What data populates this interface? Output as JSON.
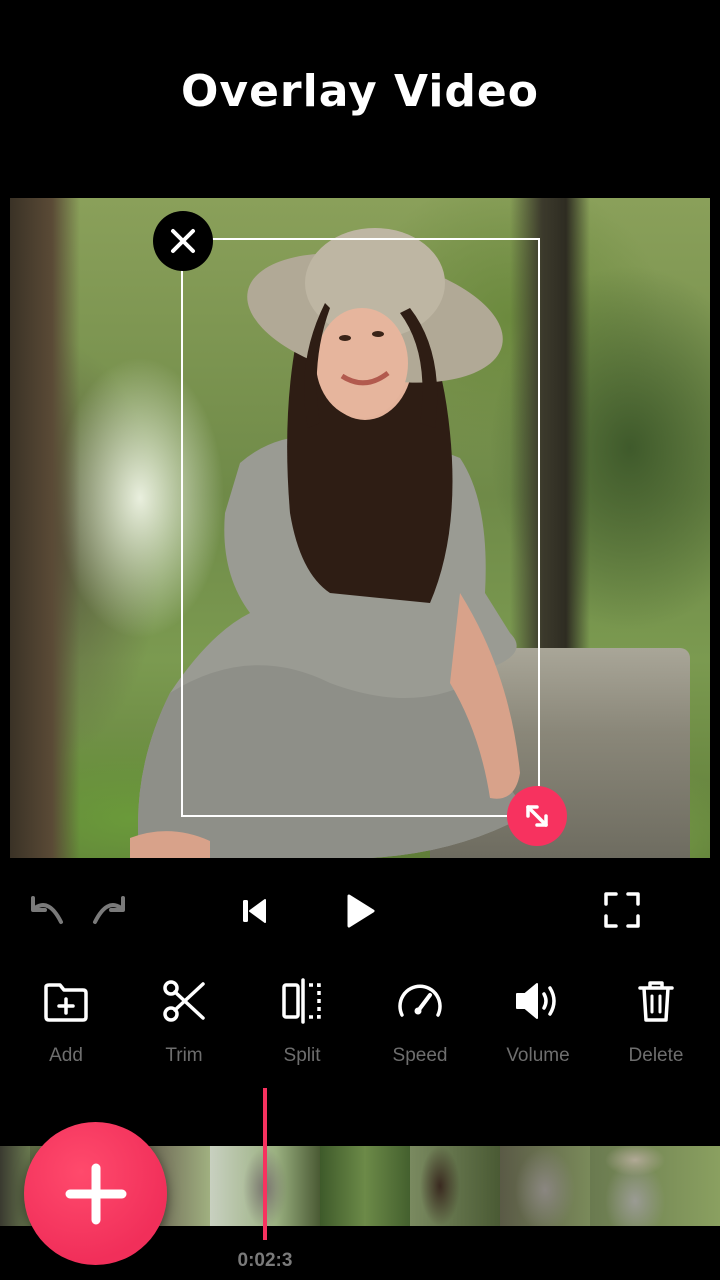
{
  "header": {
    "title": "Overlay Video"
  },
  "controls": {
    "undo_icon": "undo-icon",
    "redo_icon": "redo-icon",
    "skip_back_icon": "skip-back-icon",
    "play_icon": "play-icon",
    "fullscreen_icon": "fullscreen-icon"
  },
  "tools": [
    {
      "label": "Add",
      "icon": "add-folder-icon"
    },
    {
      "label": "Trim",
      "icon": "scissors-icon"
    },
    {
      "label": "Split",
      "icon": "split-icon"
    },
    {
      "label": "Speed",
      "icon": "speedometer-icon"
    },
    {
      "label": "Volume",
      "icon": "volume-icon"
    },
    {
      "label": "Delete",
      "icon": "trash-icon"
    }
  ],
  "timeline": {
    "timecode": "0:02:3"
  },
  "colors": {
    "accent": "#f7325f",
    "background": "#000000",
    "tool_label": "#6e6e6e"
  }
}
